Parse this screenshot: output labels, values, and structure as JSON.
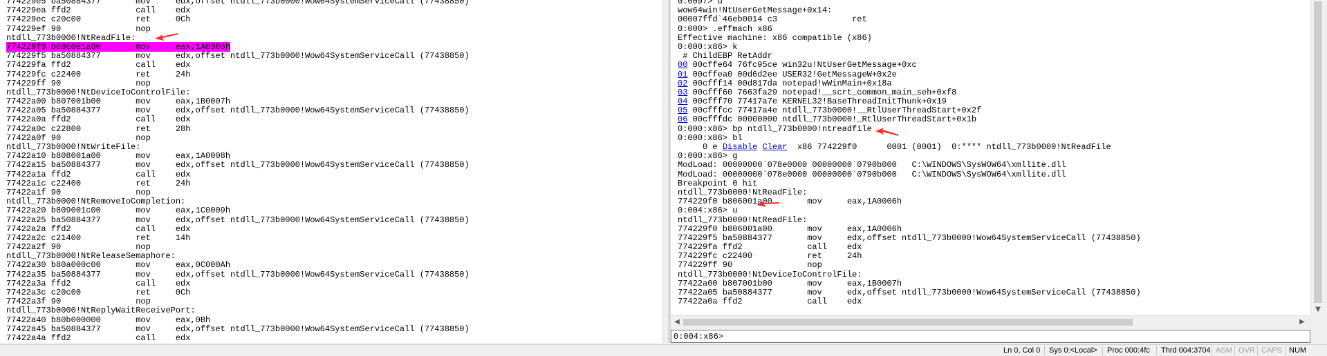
{
  "left_disassembly": [
    {
      "text": "774229e5 ba50884377       mov     edx,offset ntdll_773b0000!Wow64SystemServiceCall (77438850)"
    },
    {
      "text": "774229ea ffd2             call    edx"
    },
    {
      "text": "774229ec c20c00           ret     0Ch"
    },
    {
      "text": "774229ef 90               nop"
    },
    {
      "text": "ntdll_773b0000!NtReadFile:"
    },
    {
      "text": "774229f0 b806001a00       mov     eax,1A0006h",
      "highlight": true
    },
    {
      "text": "774229f5 ba50884377       mov     edx,offset ntdll_773b0000!Wow64SystemServiceCall (77438850)"
    },
    {
      "text": "774229fa ffd2             call    edx"
    },
    {
      "text": "774229fc c22400           ret     24h"
    },
    {
      "text": "774229ff 90               nop"
    },
    {
      "text": "ntdll_773b0000!NtDeviceIoControlFile:"
    },
    {
      "text": "77422a00 b807001b00       mov     eax,1B0007h"
    },
    {
      "text": "77422a05 ba50884377       mov     edx,offset ntdll_773b0000!Wow64SystemServiceCall (77438850)"
    },
    {
      "text": "77422a0a ffd2             call    edx"
    },
    {
      "text": "77422a0c c22800           ret     28h"
    },
    {
      "text": "77422a0f 90               nop"
    },
    {
      "text": "ntdll_773b0000!NtWriteFile:"
    },
    {
      "text": "77422a10 b808001a00       mov     eax,1A0008h"
    },
    {
      "text": "77422a15 ba50884377       mov     edx,offset ntdll_773b0000!Wow64SystemServiceCall (77438850)"
    },
    {
      "text": "77422a1a ffd2             call    edx"
    },
    {
      "text": "77422a1c c22400           ret     24h"
    },
    {
      "text": "77422a1f 90               nop"
    },
    {
      "text": "ntdll_773b0000!NtRemoveIoCompletion:"
    },
    {
      "text": "77422a20 b809001c00       mov     eax,1C0009h"
    },
    {
      "text": "77422a25 ba50884377       mov     edx,offset ntdll_773b0000!Wow64SystemServiceCall (77438850)"
    },
    {
      "text": "77422a2a ffd2             call    edx"
    },
    {
      "text": "77422a2c c21400           ret     14h"
    },
    {
      "text": "77422a2f 90               nop"
    },
    {
      "text": "ntdll_773b0000!NtReleaseSemaphore:"
    },
    {
      "text": "77422a30 b80a000c00       mov     eax,0C000Ah"
    },
    {
      "text": "77422a35 ba50884377       mov     edx,offset ntdll_773b0000!Wow64SystemServiceCall (77438850)"
    },
    {
      "text": "77422a3a ffd2             call    edx"
    },
    {
      "text": "77422a3c c20c00           ret     0Ch"
    },
    {
      "text": "77422a3f 90               nop"
    },
    {
      "text": "ntdll_773b0000!NtReplyWaitReceivePort:"
    },
    {
      "text": "77422a40 b80b000000       mov     eax,0Bh"
    },
    {
      "text": "77422a45 ba50884377       mov     edx,offset ntdll_773b0000!Wow64SystemServiceCall (77438850)"
    },
    {
      "text": "77422a4a ffd2             call    edx"
    }
  ],
  "right_output": [
    {
      "text": "0:0097> u"
    },
    {
      "text": "wow64win!NtUserGetMessage+0x14:"
    },
    {
      "text": "00007ffd`46eb0014 c3               ret"
    },
    {
      "text": "0:000> .effmach x86"
    },
    {
      "text": "Effective machine: x86 compatible (x86)"
    },
    {
      "text": "0:000:x86> k"
    },
    {
      "text": " # ChildEBP RetAddr"
    },
    {
      "link": "00",
      "text": " 00cffe64 76fc95ce win32u!NtUserGetMessage+0xc"
    },
    {
      "link": "01",
      "text": " 00cffea0 00d6d2ee USER32!GetMessageW+0x2e"
    },
    {
      "link": "02",
      "text": " 00cfff14 00d817da notepad!wWinMain+0x18a"
    },
    {
      "link": "03",
      "text": " 00cfff60 7663fa29 notepad!__scrt_common_main_seh+0xf8"
    },
    {
      "link": "04",
      "text": " 00cfff70 77417a7e KERNEL32!BaseThreadInitThunk+0x19"
    },
    {
      "link": "05",
      "text": " 00cfffcc 77417a4e ntdll_773b0000!__RtlUserThreadStart+0x2f"
    },
    {
      "link": "06",
      "text": " 00cfffdc 00000000 ntdll_773b0000!_RtlUserThreadStart+0x1b"
    },
    {
      "text": "0:000:x86> bp ntdll_773b0000!ntreadfile"
    },
    {
      "text": "0:000:x86> bl"
    },
    {
      "bl": true,
      "pre": "     0 e ",
      "disable": "Disable",
      "clear": "Clear",
      "post": "  x86 774229f0      0001 (0001)  0:**** ntdll_773b0000!NtReadFile"
    },
    {
      "text": "0:000:x86> g"
    },
    {
      "text": "ModLoad: 00000000`078e0000 00000000`0790b000   C:\\WINDOWS\\SysWOW64\\xmllite.dll"
    },
    {
      "text": "ModLoad: 00000000`078e0000 00000000`0790b000   C:\\WINDOWS\\SysWOW64\\xmllite.dll"
    },
    {
      "text": "Breakpoint 0 hit"
    },
    {
      "text": "ntdll_773b0000!NtReadFile:"
    },
    {
      "text": "774229f0 b806001a00       mov     eax,1A0006h"
    },
    {
      "text": "0:004:x86> u"
    },
    {
      "text": "ntdll_773b0000!NtReadFile:"
    },
    {
      "text": "774229f0 b806001a00       mov     eax,1A0006h"
    },
    {
      "text": "774229f5 ba50884377       mov     edx,offset ntdll_773b0000!Wow64SystemServiceCall (77438850)"
    },
    {
      "text": "774229fa ffd2             call    edx"
    },
    {
      "text": "774229fc c22400           ret     24h"
    },
    {
      "text": "774229ff 90               nop"
    },
    {
      "text": "ntdll_773b0000!NtDeviceIoControlFile:"
    },
    {
      "text": "77422a00 b807001b00       mov     eax,1B0007h"
    },
    {
      "text": "77422a05 ba50884377       mov     edx,offset ntdll_773b0000!Wow64SystemServiceCall (77438850)"
    },
    {
      "text": "77422a0a ffd2             call    edx"
    }
  ],
  "command": {
    "prompt": "0:004:x86>",
    "value": ""
  },
  "status_bar": {
    "position": "Ln 0, Col 0",
    "session": "Sys 0:<Local>",
    "process": "Proc 000:4fc",
    "thread": "Thrd 004:3704",
    "asm": "ASM",
    "ovr": "OVR",
    "caps": "CAPS",
    "num": "NUM"
  },
  "annotation_color": "#ff2a2a",
  "highlight_color": "#ff00ff"
}
